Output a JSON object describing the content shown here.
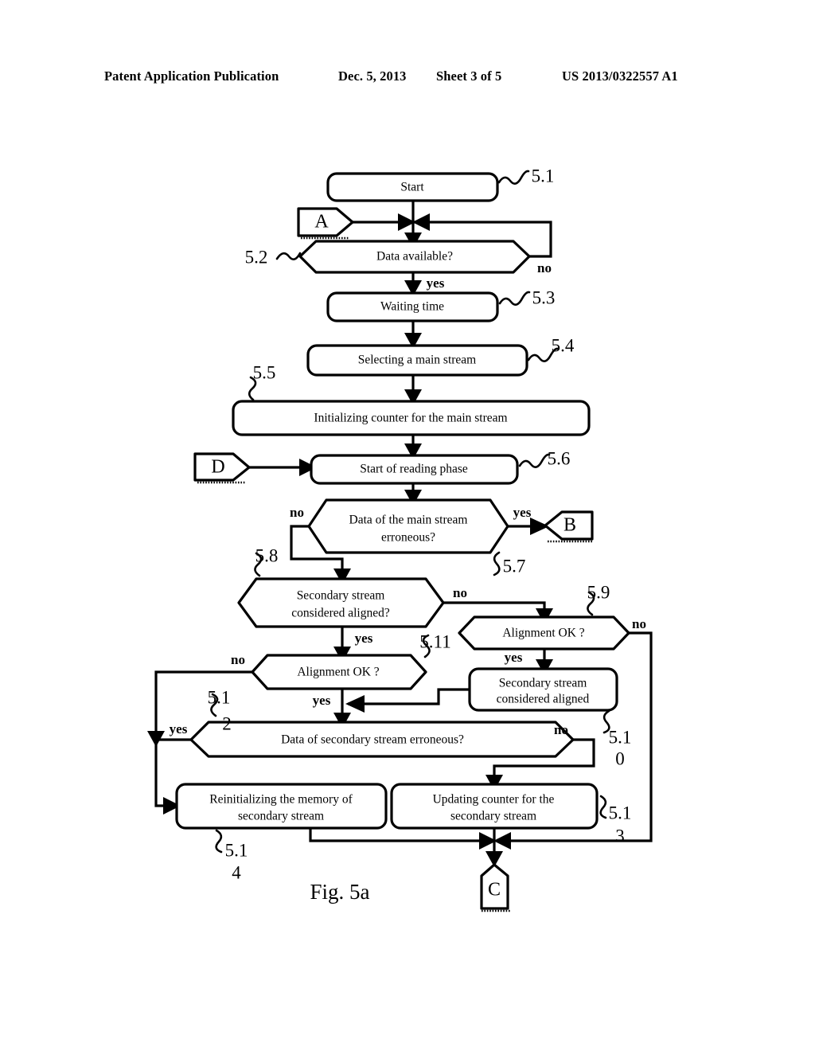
{
  "header": {
    "publication": "Patent Application Publication",
    "date": "Dec. 5, 2013",
    "sheet": "Sheet 3 of 5",
    "number": "US 2013/0322557 A1"
  },
  "figure": {
    "caption": "Fig. 5a",
    "nodes": {
      "start": "Start",
      "data_available": "Data available?",
      "waiting_time": "Waiting time",
      "selecting_main_stream": "Selecting a main stream",
      "initializing_counter": "Initializing counter for the main stream",
      "start_reading_phase": "Start of reading phase",
      "main_stream_erroneous_l1": "Data of the main stream",
      "main_stream_erroneous_l2": "erroneous?",
      "secondary_aligned_q_l1": "Secondary stream",
      "secondary_aligned_q_l2": "considered aligned?",
      "alignment_ok_right": "Alignment OK ?",
      "alignment_ok_left": "Alignment OK ?",
      "secondary_aligned_set_l1": "Secondary stream",
      "secondary_aligned_set_l2": "considered aligned",
      "secondary_erroneous": "Data of secondary stream erroneous?",
      "reinitializing_l1": "Reinitializing the memory of",
      "reinitializing_l2": "secondary stream",
      "updating_counter_l1": "Updating counter for the",
      "updating_counter_l2": "secondary stream"
    },
    "connectors": {
      "a": "A",
      "b": "B",
      "c": "C",
      "d": "D"
    },
    "refs": {
      "r51": "5.1",
      "r52": "5.2",
      "r53": "5.3",
      "r54": "5.4",
      "r55": "5.5",
      "r56": "5.6",
      "r57": "5.7",
      "r58": "5.8",
      "r59": "5.9",
      "r510_a": "5.1",
      "r510_b": "0",
      "r511": "5.11",
      "r512_a": "5.1",
      "r512_b": "2",
      "r513_a": "5.1",
      "r513_b": "3",
      "r514_a": "5.1",
      "r514_b": "4"
    },
    "labels": {
      "no": "no",
      "yes": "yes"
    },
    "colors": {
      "ink": "#000000",
      "paper": "#ffffff"
    }
  }
}
